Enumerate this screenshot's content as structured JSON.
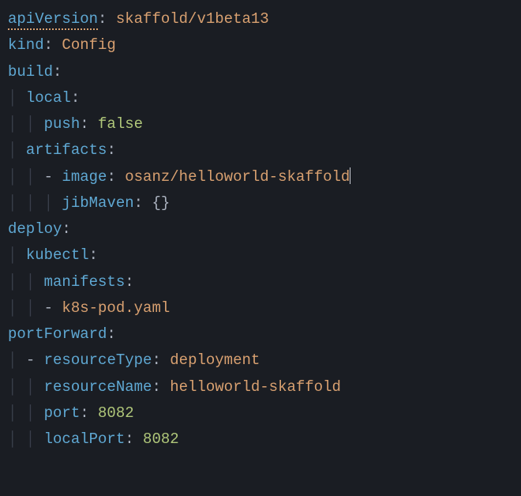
{
  "lines": {
    "l1_key": "apiVersion",
    "l1_val": "skaffold/v1beta13",
    "l2_key": "kind",
    "l2_val": "Config",
    "l3_key": "build",
    "l4_key": "local",
    "l5_key": "push",
    "l5_val": "false",
    "l6_key": "artifacts",
    "l7_key": "image",
    "l7_val": "osanz/helloworld-skaffold",
    "l8_key": "jibMaven",
    "l8_val": "{}",
    "l9_key": "deploy",
    "l10_key": "kubectl",
    "l11_key": "manifests",
    "l12_val": "k8s-pod.yaml",
    "l13_key": "portForward",
    "l14_key": "resourceType",
    "l14_val": "deployment",
    "l15_key": "resourceName",
    "l15_val": "helloworld-skaffold",
    "l16_key": "port",
    "l16_val": "8082",
    "l17_key": "localPort",
    "l17_val": "8082"
  },
  "indent": {
    "dash": "- ",
    "g1": "│ ",
    "g2": "│ │ ",
    "g3": "│ │ │ "
  }
}
